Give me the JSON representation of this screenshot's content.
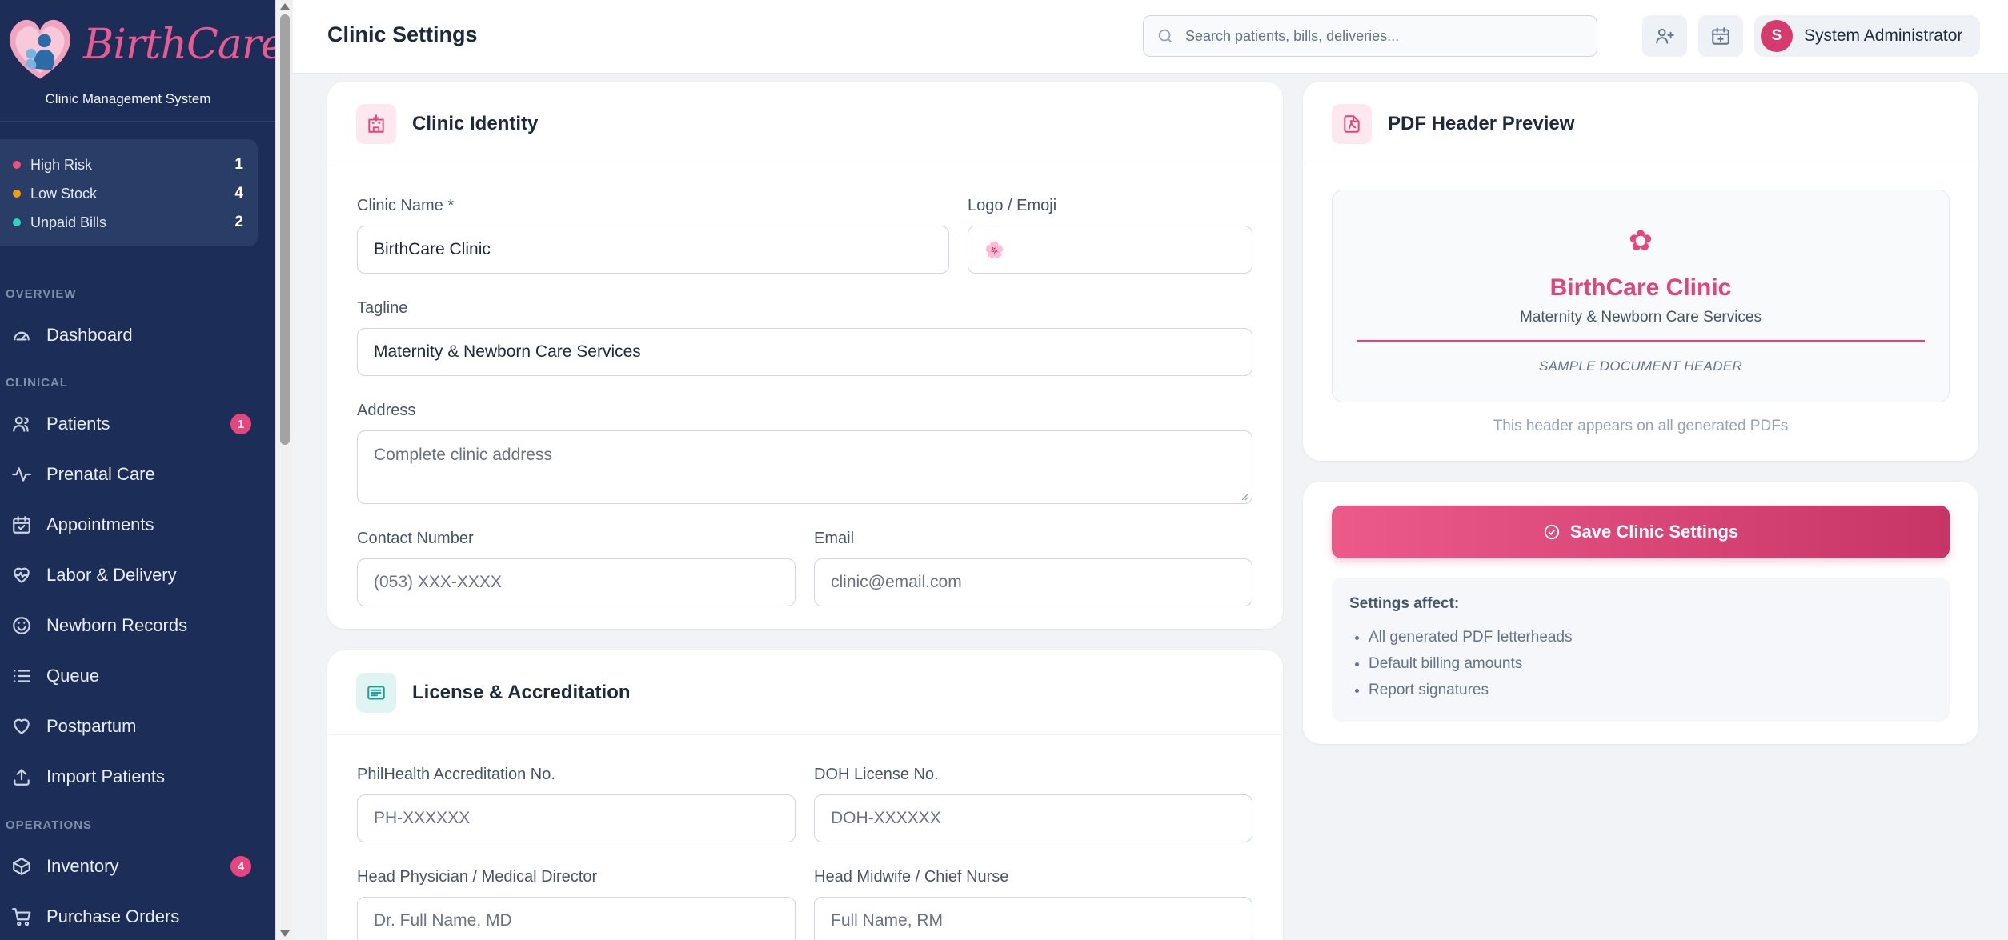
{
  "brand": {
    "name": "BirthCare",
    "subtitle": "Clinic Management System"
  },
  "alerts": [
    {
      "label": "High Risk",
      "count": "1",
      "color": "#f0517f"
    },
    {
      "label": "Low Stock",
      "count": "4",
      "color": "#f59e0b"
    },
    {
      "label": "Unpaid Bills",
      "count": "2",
      "color": "#2dd4bf"
    }
  ],
  "nav": {
    "sections": {
      "overview": "OVERVIEW",
      "clinical": "CLINICAL",
      "operations": "OPERATIONS"
    },
    "items": {
      "dashboard": {
        "label": "Dashboard",
        "icon": "gauge-icon"
      },
      "patients": {
        "label": "Patients",
        "icon": "users-icon",
        "badge": "1"
      },
      "prenatal": {
        "label": "Prenatal Care",
        "icon": "activity-icon"
      },
      "appointments": {
        "label": "Appointments",
        "icon": "calendar-check-icon"
      },
      "labor": {
        "label": "Labor & Delivery",
        "icon": "heart-pulse-icon"
      },
      "newborn": {
        "label": "Newborn Records",
        "icon": "smile-icon"
      },
      "queue": {
        "label": "Queue",
        "icon": "list-icon"
      },
      "postpartum": {
        "label": "Postpartum",
        "icon": "heart-icon"
      },
      "import": {
        "label": "Import Patients",
        "icon": "upload-icon"
      },
      "inventory": {
        "label": "Inventory",
        "icon": "box-icon",
        "badge": "4"
      },
      "purchase": {
        "label": "Purchase Orders",
        "icon": "cart-icon"
      }
    }
  },
  "header": {
    "title": "Clinic Settings",
    "search_placeholder": "Search patients, bills, deliveries...",
    "user_name": "System Administrator",
    "user_initial": "S"
  },
  "identity": {
    "title": "Clinic Identity",
    "clinic_name_label": "Clinic Name *",
    "clinic_name_value": "BirthCare Clinic",
    "logo_label": "Logo / Emoji",
    "logo_value": "🌸",
    "tagline_label": "Tagline",
    "tagline_value": "Maternity & Newborn Care Services",
    "address_label": "Address",
    "address_placeholder": "Complete clinic address",
    "contact_label": "Contact Number",
    "contact_placeholder": "(053) XXX-XXXX",
    "email_label": "Email",
    "email_placeholder": "clinic@email.com"
  },
  "license": {
    "title": "License & Accreditation",
    "philhealth_label": "PhilHealth Accreditation No.",
    "philhealth_placeholder": "PH-XXXXXX",
    "doh_label": "DOH License No.",
    "doh_placeholder": "DOH-XXXXXX",
    "physician_label": "Head Physician / Medical Director",
    "physician_placeholder": "Dr. Full Name, MD",
    "midwife_label": "Head Midwife / Chief Nurse",
    "midwife_placeholder": "Full Name, RM"
  },
  "preview": {
    "title": "PDF Header Preview",
    "emoji": "✿",
    "clinic_name": "BirthCare Clinic",
    "tagline": "Maternity & Newborn Care Services",
    "sample": "SAMPLE DOCUMENT HEADER",
    "note": "This header appears on all generated PDFs"
  },
  "save": {
    "label": "Save Clinic Settings",
    "affects_title": "Settings affect:",
    "affects": [
      "All generated PDF letterheads",
      "Default billing amounts",
      "Report signatures"
    ]
  },
  "colors": {
    "sidebar": "#1c2e57",
    "accent": "#e0457a",
    "badge": "#e8457e"
  }
}
